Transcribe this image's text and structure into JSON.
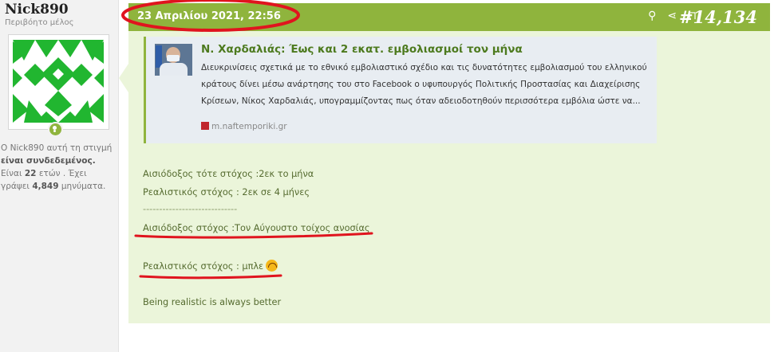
{
  "user": {
    "name": "Nick890",
    "title": "Περιβόητο μέλος",
    "status_intro": "Ο Nick890 αυτή τη στιγμή",
    "status_online": "είναι συνδεδεμένος.",
    "age_prefix": "Είναι",
    "age": "22",
    "age_suffix": "ετών . Έχει",
    "posts_prefix": "γράψει",
    "posts": "4,849",
    "posts_suffix": "μηνύματα."
  },
  "post": {
    "date": "23 Απριλίου 2021, 22:56",
    "number": "#14,134",
    "header_icons": [
      "search-icon",
      "share-icon",
      "bookmark-icon"
    ],
    "embed": {
      "title": "Ν. Χαρδαλιάς: Έως και 2 εκατ. εμβολιασμοί τον μήνα",
      "description": "Διευκρινίσεις σχετικά με το εθνικό εμβολιαστικό σχέδιο και τις δυνατότητες εμβολιασμού του ελληνικού κράτους δίνει μέσω ανάρτησης του στο Facebook ο υφυπουργός Πολιτικής Προστασίας και Διαχείρισης Κρίσεων, Νίκος Χαρδαλιάς, υπογραμμίζοντας πως όταν αδειοδοτηθούν περισσότερα εμβόλια ώστε να...",
      "source": "m.naftemporiki.gr"
    },
    "lines": {
      "optimistic_then": "Αισιόδοξος τότε στόχος :2εκ το μήνα",
      "realistic_then": "Ρεαλιστικός στόχος : 2εκ σε 4 μήνες",
      "separator": "-----------------------------",
      "optimistic_now": "Αισιόδοξος στόχος :Τον Αύγουστο τοίχος ανοσίας",
      "realistic_now": "Ρεαλιστικός στόχος : μπλε",
      "closing": "Being realistic is always better"
    }
  },
  "colors": {
    "accent": "#8fb43d",
    "message_bg": "#ebf5da",
    "annotation": "#e0141e"
  }
}
